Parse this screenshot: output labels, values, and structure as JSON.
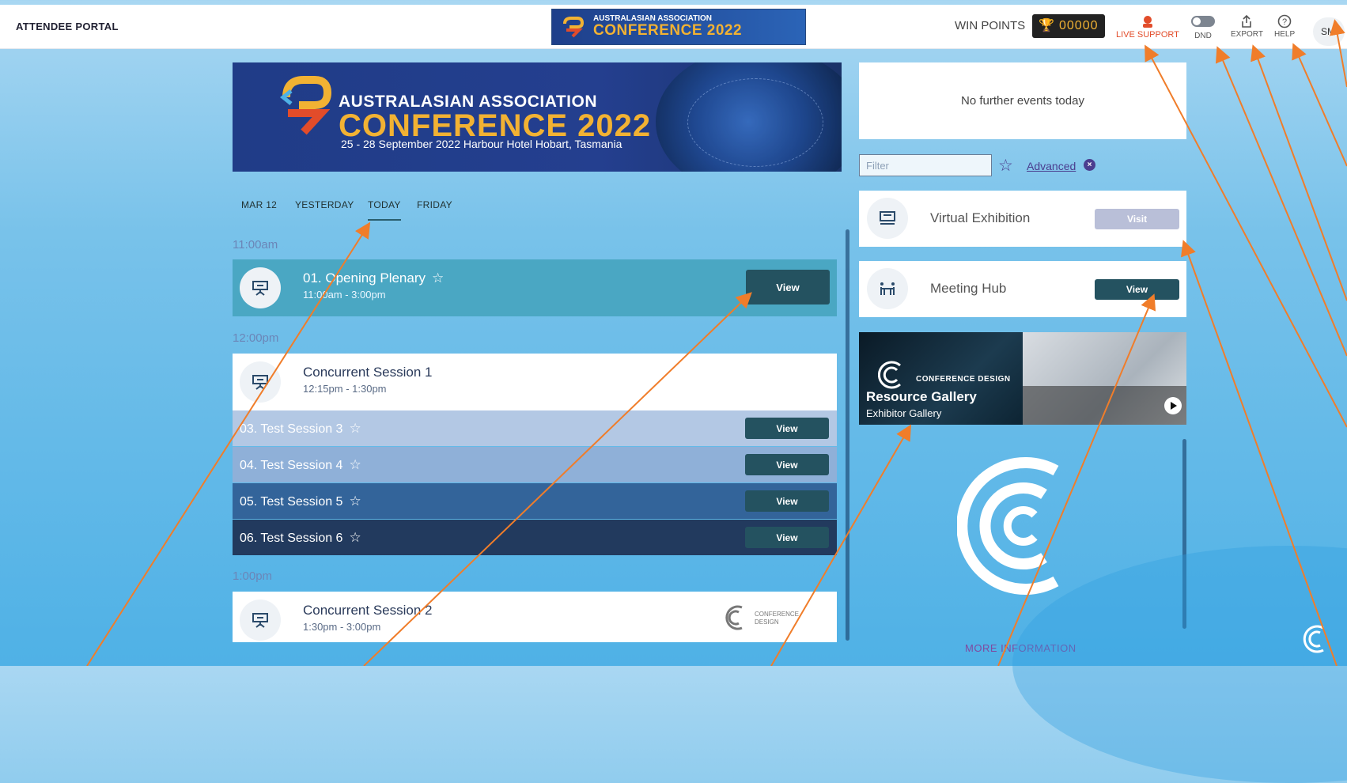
{
  "header": {
    "portal_title": "ATTENDEE PORTAL",
    "banner_line1": "AUSTRALASIAN ASSOCIATION",
    "banner_line2": "CONFERENCE 2022",
    "win_points_label": "WIN POINTS",
    "win_points_value": "00000",
    "live_support_label": "LIVE SUPPORT",
    "dnd_label": "DND",
    "export_label": "EXPORT",
    "help_label": "HELP",
    "avatar_initials": "SM"
  },
  "main_banner": {
    "line1": "AUSTRALASIAN ASSOCIATION",
    "line2": "CONFERENCE 2022",
    "line3": "25 - 28 September 2022  Harbour Hotel   Hobart, Tasmania"
  },
  "tabs": [
    {
      "label": "MAR 12",
      "active": false
    },
    {
      "label": "YESTERDAY",
      "active": false
    },
    {
      "label": "TODAY",
      "active": true
    },
    {
      "label": "FRIDAY",
      "active": false
    }
  ],
  "schedule": {
    "time1": "11:00am",
    "opening": {
      "title": "01. Opening Plenary",
      "time": "11:00am - 3:00pm",
      "button": "View"
    },
    "time2": "12:00pm",
    "concurrent1": {
      "title": "Concurrent Session 1",
      "time": "12:15pm - 1:30pm"
    },
    "sub_sessions": [
      {
        "title": "03. Test Session 3",
        "button": "View",
        "color": "#b3c8e4"
      },
      {
        "title": "04. Test Session 4",
        "button": "View",
        "color": "#8fb0d8"
      },
      {
        "title": "05. Test Session 5",
        "button": "View",
        "color": "#33649a"
      },
      {
        "title": "06. Test Session 6",
        "button": "View",
        "color": "#223a5e"
      }
    ],
    "time3": "1:00pm",
    "concurrent2": {
      "title": "Concurrent Session 2",
      "time": "1:30pm - 3:00pm",
      "logo_text": "CONFERENCE DESIGN"
    }
  },
  "sidebar": {
    "no_events": "No further events today",
    "filter_placeholder": "Filter",
    "advanced_label": "Advanced",
    "virtual_exhibition": {
      "label": "Virtual Exhibition",
      "button": "Visit"
    },
    "meeting_hub": {
      "label": "Meeting Hub",
      "button": "View"
    },
    "gallery": {
      "brand": "CONFERENCE DESIGN",
      "title": "Resource Gallery",
      "subtitle": "Exhibitor Gallery"
    },
    "more_information": "MORE INFORMATION"
  },
  "colors": {
    "accent_dark": "#245260",
    "plenary": "#4aa7c3",
    "annotation_arrow": "#f07d2a",
    "live_support": "#e24c2a",
    "advanced_link": "#4b3e8f"
  },
  "icons": {
    "trophy": "trophy-icon",
    "live_support": "headset-icon",
    "dnd": "toggle-icon",
    "export": "share-icon",
    "help": "question-icon",
    "session": "presentation-icon",
    "virtual": "booth-icon",
    "meeting": "people-table-icon",
    "star": "star-icon",
    "clear": "close-circle-icon",
    "play": "play-icon"
  }
}
